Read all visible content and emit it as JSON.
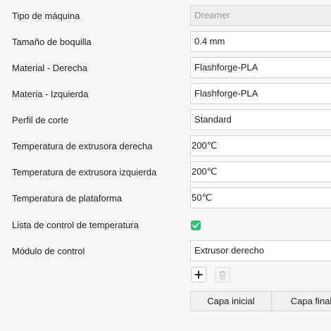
{
  "form": {
    "machine_type": {
      "label": "Tipo de máquina",
      "value": "Dreamer"
    },
    "nozzle_size": {
      "label": "Tamaño de boquilla",
      "value": "0.4 mm"
    },
    "material_right": {
      "label": "Material - Derecha",
      "value": "Flashforge-PLA"
    },
    "material_left": {
      "label": "Materia - Izquierda",
      "value": "Flashforge-PLA"
    },
    "slice_profile": {
      "label": "Perfil de corte",
      "value": "Standard"
    },
    "temp_right_extruder": {
      "label": "Temperatura de extrusora derecha",
      "value": "200℃"
    },
    "temp_left_extruder": {
      "label": "Temperatura de extrusora izquierda",
      "value": "200℃"
    },
    "temp_platform": {
      "label": "Temperatura de plataforma",
      "value": "50℃"
    },
    "temp_control_list": {
      "label": "Lista de control de temperatura",
      "checked": true
    },
    "control_module": {
      "label": "Módulo de control",
      "value": "Extrusor derecho"
    }
  },
  "table": {
    "columns": [
      "Capa inicial",
      "Capa final"
    ]
  },
  "icons": {
    "add": "plus-icon",
    "delete": "trash-icon",
    "check": "checkmark-icon"
  },
  "colors": {
    "checkbox": "#2fbf7a",
    "disabled_field": "#efefef"
  }
}
